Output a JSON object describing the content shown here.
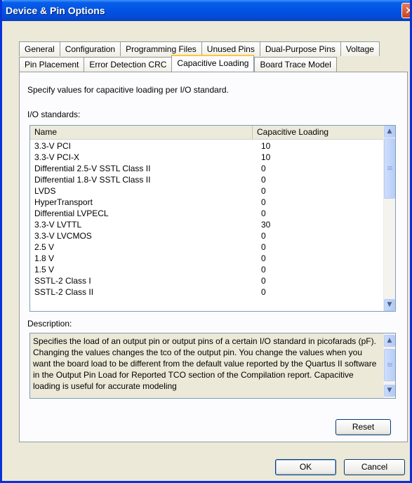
{
  "window": {
    "title": "Device & Pin Options",
    "close_glyph": "✕"
  },
  "tabs_row1": [
    {
      "label": "General"
    },
    {
      "label": "Configuration"
    },
    {
      "label": "Programming Files"
    },
    {
      "label": "Unused Pins"
    },
    {
      "label": "Dual-Purpose Pins"
    },
    {
      "label": "Voltage"
    }
  ],
  "tabs_row2": [
    {
      "label": "Pin Placement"
    },
    {
      "label": "Error Detection CRC"
    },
    {
      "label": "Capacitive Loading",
      "active": true
    },
    {
      "label": "Board Trace Model"
    }
  ],
  "panel": {
    "instruction": "Specify values for capacitive loading per I/O standard.",
    "io_label": "I/O standards:",
    "columns": [
      "Name",
      "Capacitive Loading"
    ],
    "rows": [
      {
        "name": "3.3-V PCI",
        "value": "10"
      },
      {
        "name": "3.3-V PCI-X",
        "value": "10"
      },
      {
        "name": "Differential 2.5-V SSTL Class II",
        "value": "0"
      },
      {
        "name": "Differential 1.8-V SSTL Class II",
        "value": "0"
      },
      {
        "name": "LVDS",
        "value": "0"
      },
      {
        "name": "HyperTransport",
        "value": "0"
      },
      {
        "name": "Differential LVPECL",
        "value": "0"
      },
      {
        "name": "3.3-V LVTTL",
        "value": "30"
      },
      {
        "name": "3.3-V LVCMOS",
        "value": "0"
      },
      {
        "name": "2.5 V",
        "value": "0"
      },
      {
        "name": "1.8 V",
        "value": "0"
      },
      {
        "name": "1.5 V",
        "value": "0"
      },
      {
        "name": "SSTL-2 Class I",
        "value": "0"
      },
      {
        "name": "SSTL-2 Class II",
        "value": "0"
      }
    ],
    "description_label": "Description:",
    "description": "Specifies the load of an output pin or output pins of a certain I/O standard in picofarads (pF). Changing the values changes the tco of the output pin. You change the values when you want the board load to be different from the default value reported by the Quartus II software in the Output Pin Load for Reported TCO section of the Compilation report. Capacitive loading is useful for accurate modeling",
    "reset_label": "Reset"
  },
  "footer": {
    "ok_label": "OK",
    "cancel_label": "Cancel"
  },
  "icons": {
    "scroll_up": "▲",
    "scroll_down": "▼"
  },
  "colors": {
    "titlebar": "#0054e3",
    "dialog_bg": "#ece9d8",
    "active_tab_highlight": "#ffc83c"
  }
}
